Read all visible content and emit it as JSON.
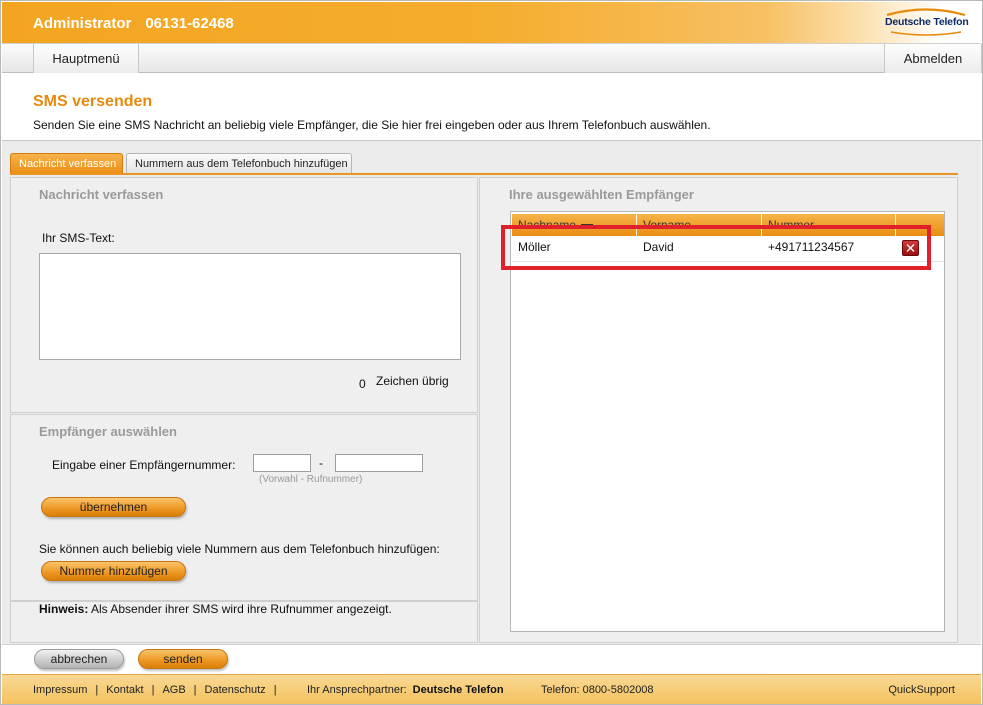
{
  "header": {
    "user": "Administrator",
    "phone": "06131-62468",
    "logo_text": "Deutsche Telefon"
  },
  "nav": {
    "main_menu": "Hauptmenü",
    "logout": "Abmelden"
  },
  "page": {
    "title": "SMS versenden",
    "description": "Senden Sie eine SMS Nachricht an beliebig viele Empfänger, die Sie hier frei eingeben oder aus Ihrem Telefonbuch auswählen."
  },
  "tabs": [
    {
      "label": "Nachricht verfassen",
      "active": true
    },
    {
      "label": "Nummern aus dem Telefonbuch hinzufügen",
      "active": false
    }
  ],
  "compose": {
    "title": "Nachricht verfassen",
    "sms_label": "Ihr SMS-Text:",
    "sms_value": "",
    "chars_left_count": "0",
    "chars_left_label": "Zeichen übrig"
  },
  "recipient": {
    "title": "Empfänger auswählen",
    "input_label": "Eingabe einer Empfängernummer:",
    "area_code_value": "",
    "number_value": "",
    "dash": "-",
    "format_hint": "(Vorwahl - Rufnummer)",
    "apply_button": "übernehmen",
    "phonebook_text": "Sie können auch beliebig viele Nummern aus dem Telefonbuch hinzufügen:",
    "add_number_button": "Nummer hinzufügen"
  },
  "hint": {
    "label": "Hinweis:",
    "text": "Als Absender ihrer SMS wird ihre Rufnummer angezeigt."
  },
  "selected": {
    "title": "Ihre ausgewählten Empfänger",
    "columns": [
      "Nachname",
      "Vorname",
      "Nummer"
    ],
    "rows": [
      {
        "nachname": "Möller",
        "vorname": "David",
        "nummer": "+491711234567"
      }
    ]
  },
  "actions": {
    "cancel": "abbrechen",
    "send": "senden"
  },
  "footer": {
    "links": [
      "Impressum",
      "Kontakt",
      "AGB",
      "Datenschutz"
    ],
    "separator": "|",
    "contact_label": "Ihr Ansprechpartner:",
    "contact_name": "Deutsche Telefon",
    "phone": "Telefon: 0800-5802008",
    "quicksupport": "QuickSupport"
  },
  "colors": {
    "accent": "#e58a0e",
    "highlight": "#e0202a"
  }
}
